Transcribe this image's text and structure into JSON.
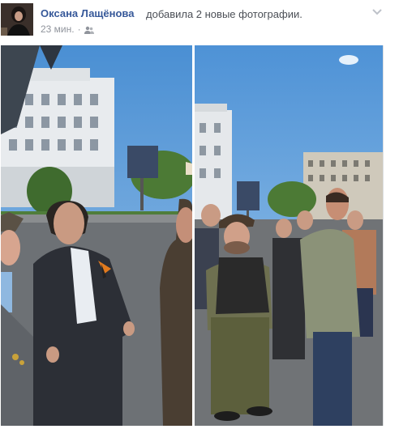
{
  "post": {
    "author": "Оксана Лащёнова",
    "action": "добавила 2 новые фотографии.",
    "timestamp": "23 мин.",
    "separator": "·",
    "audience_icon": "friends-icon",
    "options_icon": "chevron-down-icon"
  },
  "photos": [
    {
      "name": "photo-left"
    },
    {
      "name": "photo-right"
    }
  ],
  "colors": {
    "author_link": "#365899",
    "meta_text": "#90949c",
    "sky": "#5d9bd6"
  }
}
